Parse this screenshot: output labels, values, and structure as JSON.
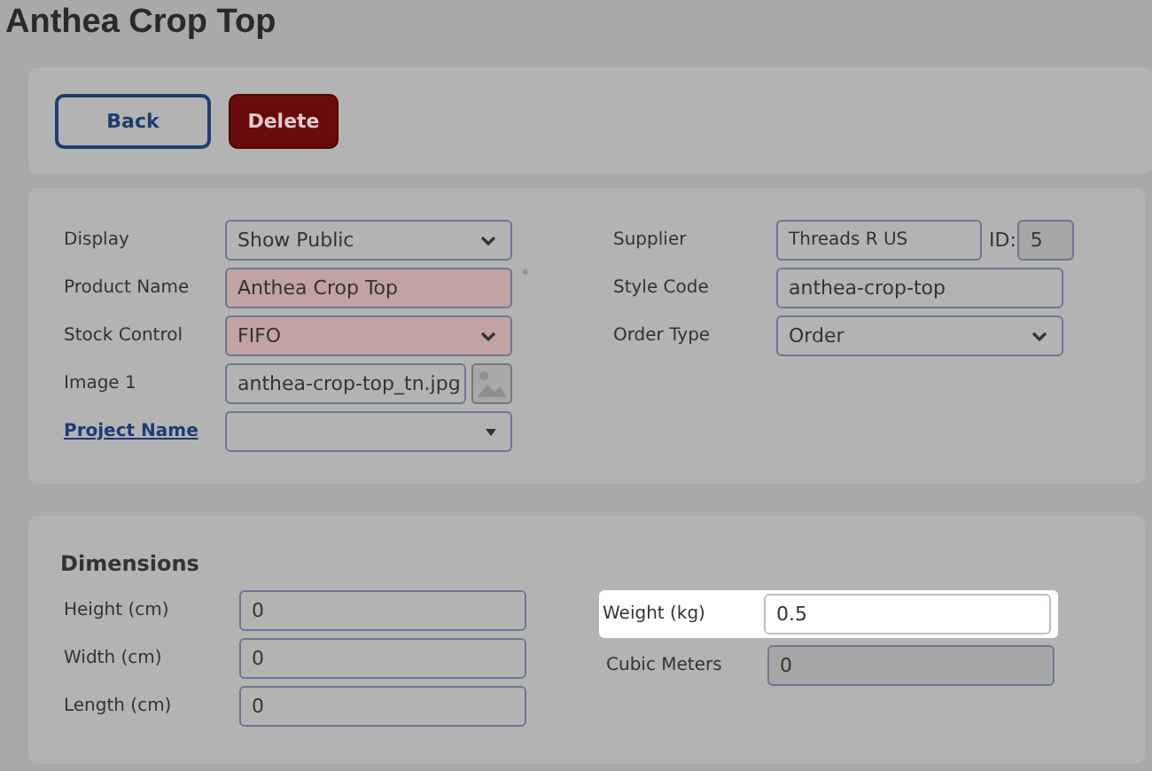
{
  "title": "Anthea Crop Top",
  "buttons": [
    {
      "label": "Back",
      "kind": "outline"
    },
    {
      "label": "Delete",
      "kind": "danger"
    }
  ],
  "product_left": [
    {
      "label": "Display",
      "kind": "select",
      "value": "Show Public",
      "invalid": false,
      "link": false
    },
    {
      "label": "Product Name",
      "kind": "text",
      "value": "Anthea Crop Top",
      "invalid": true,
      "required_mark": "*",
      "link": false
    },
    {
      "label": "Stock Control",
      "kind": "select",
      "value": "FIFO",
      "invalid": true,
      "link": false
    },
    {
      "label": "Image 1",
      "kind": "image",
      "value": "anthea-crop-top_tn.jpg",
      "invalid": false,
      "link": false
    },
    {
      "label": "Project Name",
      "kind": "combo",
      "invalid": false,
      "link": true
    }
  ],
  "product_right": [
    {
      "label": "Supplier",
      "kind": "supplier",
      "value": "Threads R US",
      "id_label": "ID:",
      "id_value": "5"
    },
    {
      "label": "Style Code",
      "kind": "text",
      "value": "anthea-crop-top"
    },
    {
      "label": "Order Type",
      "kind": "select",
      "value": "Order"
    }
  ],
  "dimensions": {
    "title": "Dimensions",
    "left": [
      {
        "label": "Height (cm)",
        "value": "0",
        "readonly": false
      },
      {
        "label": "Width (cm)",
        "value": "0",
        "readonly": false
      },
      {
        "label": "Length (cm)",
        "value": "0",
        "readonly": false
      }
    ],
    "right": [
      {
        "label": "Weight (kg)",
        "value": "0.5",
        "highlighted": true,
        "readonly": false
      },
      {
        "label": "Cubic Meters",
        "value": "0",
        "highlighted": false,
        "readonly": true
      }
    ]
  }
}
